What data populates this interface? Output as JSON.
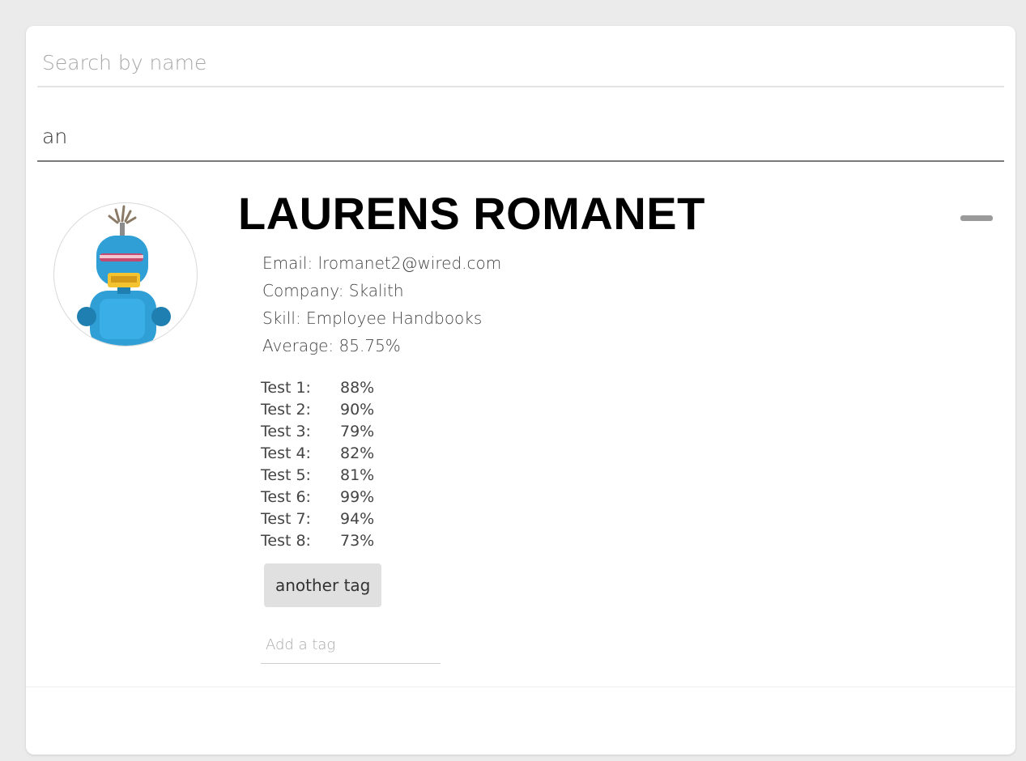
{
  "search": {
    "name_placeholder": "Search by name",
    "name_value": "",
    "tag_value": "an"
  },
  "student": {
    "name": "LAURENS ROMANET",
    "avatar_icon": "robot-avatar-icon",
    "collapse_icon": "minus-icon",
    "email": "Email: lromanet2@wired.com",
    "company": "Company: Skalith",
    "skill": "Skill: Employee Handbooks",
    "average": "Average: 85.75%",
    "tests": [
      {
        "label": "Test 1:",
        "score": "88%"
      },
      {
        "label": "Test 2:",
        "score": "90%"
      },
      {
        "label": "Test 3:",
        "score": "79%"
      },
      {
        "label": "Test 4:",
        "score": "82%"
      },
      {
        "label": "Test 5:",
        "score": "81%"
      },
      {
        "label": "Test 6:",
        "score": "99%"
      },
      {
        "label": "Test 7:",
        "score": "94%"
      },
      {
        "label": "Test 8:",
        "score": "73%"
      }
    ],
    "tags": [
      "another tag"
    ],
    "add_tag_placeholder": "Add a tag"
  },
  "colors": {
    "background": "#ebebeb",
    "card": "#ffffff",
    "robot_blue": "#2f9fd6",
    "tag_chip": "#e0e0e0"
  }
}
